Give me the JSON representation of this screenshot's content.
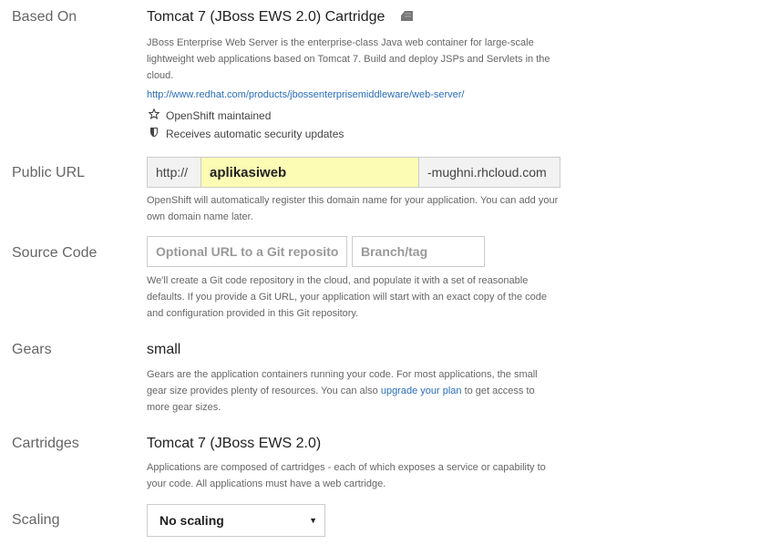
{
  "based_on": {
    "label": "Based On",
    "title": "Tomcat 7 (JBoss EWS 2.0) Cartridge",
    "icon": "cartridge-icon",
    "description": "JBoss Enterprise Web Server is the enterprise-class Java web container for large-scale lightweight web applications based on Tomcat 7. Build and deploy JSPs and Servlets in the cloud.",
    "link": "http://www.redhat.com/products/jbossenterprisemiddleware/web-server/",
    "features": [
      {
        "icon": "star-icon",
        "text": "OpenShift maintained"
      },
      {
        "icon": "shield-icon",
        "text": "Receives automatic security updates"
      }
    ]
  },
  "public_url": {
    "label": "Public URL",
    "prefix": "http://",
    "value": "aplikasiweb",
    "suffix": "-mughni.rhcloud.com",
    "help": "OpenShift will automatically register this domain name for your application. You can add your own domain name later."
  },
  "source_code": {
    "label": "Source Code",
    "repo_placeholder": "Optional URL to a Git repository",
    "branch_placeholder": "Branch/tag",
    "help": "We'll create a Git code repository in the cloud, and populate it with a set of reasonable defaults. If you provide a Git URL, your application will start with an exact copy of the code and configuration provided in this Git repository."
  },
  "gears": {
    "label": "Gears",
    "value": "small",
    "help_before": "Gears are the application containers running your code. For most applications, the small gear size provides plenty of resources. You can also ",
    "help_link": "upgrade your plan",
    "help_after": " to get access to more gear sizes."
  },
  "cartridges": {
    "label": "Cartridges",
    "value": "Tomcat 7 (JBoss EWS 2.0)",
    "help": "Applications are composed of cartridges - each of which exposes a service or capability to your code. All applications must have a web cartridge."
  },
  "scaling": {
    "label": "Scaling",
    "selected": "No scaling"
  },
  "colors": {
    "link": "#2a6ebb",
    "url_input_bg": "#fcfcb4",
    "label": "#666666"
  }
}
